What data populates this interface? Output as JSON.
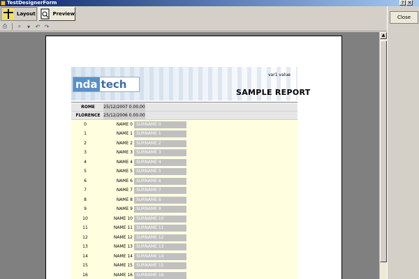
{
  "window": {
    "title": "TestDesignerForm"
  },
  "tabs": [
    {
      "label": "Layout",
      "icon": "layout-icon"
    },
    {
      "label": "Preview",
      "icon": "preview-icon"
    }
  ],
  "right_panel": {
    "close_label": "Close"
  },
  "report": {
    "logo_part1": "nda",
    "logo_part2": "tech",
    "var_text": "var1 value",
    "title": "SAMPLE REPORT",
    "groups": [
      {
        "city": "ROME",
        "date": "25/12/2007 0.00.00"
      },
      {
        "city": "FLORENCE",
        "date": "25/12/2006 0.00.00"
      }
    ],
    "rows": [
      {
        "idx": "0",
        "name": "NAME 0",
        "surname": "SURNAME 0"
      },
      {
        "idx": "1",
        "name": "NAME 1",
        "surname": "SURNAME 1"
      },
      {
        "idx": "2",
        "name": "NAME 2",
        "surname": "SURNAME 2"
      },
      {
        "idx": "3",
        "name": "NAME 3",
        "surname": "SURNAME 3"
      },
      {
        "idx": "4",
        "name": "NAME 4",
        "surname": "SURNAME 4"
      },
      {
        "idx": "5",
        "name": "NAME 5",
        "surname": "SURNAME 5"
      },
      {
        "idx": "6",
        "name": "NAME 6",
        "surname": "SURNAME 6"
      },
      {
        "idx": "7",
        "name": "NAME 7",
        "surname": "SURNAME 7"
      },
      {
        "idx": "8",
        "name": "NAME 8",
        "surname": "SURNAME 8"
      },
      {
        "idx": "9",
        "name": "NAME 9",
        "surname": "SURNAME 9"
      },
      {
        "idx": "10",
        "name": "NAME 10",
        "surname": "SURNAME 10"
      },
      {
        "idx": "11",
        "name": "NAME 11",
        "surname": "SURNAME 11"
      },
      {
        "idx": "12",
        "name": "NAME 12",
        "surname": "SURNAME 12"
      },
      {
        "idx": "13",
        "name": "NAME 13",
        "surname": "SURNAME 13"
      },
      {
        "idx": "14",
        "name": "NAME 14",
        "surname": "SURNAME 14"
      },
      {
        "idx": "15",
        "name": "NAME 15",
        "surname": "SURNAME 15"
      },
      {
        "idx": "16",
        "name": "NAME 16",
        "surname": "SURNAME 16"
      }
    ]
  }
}
